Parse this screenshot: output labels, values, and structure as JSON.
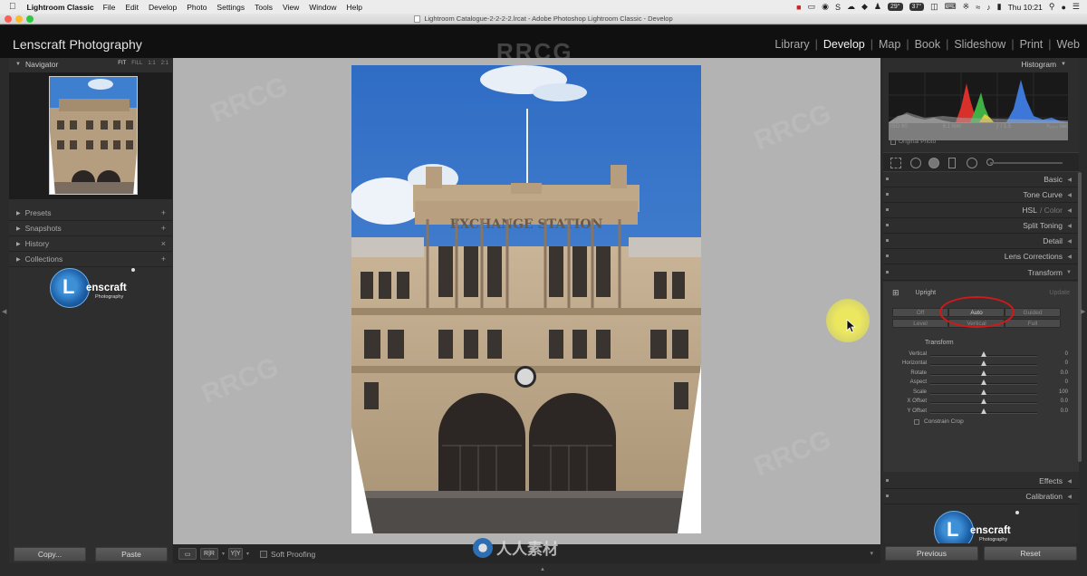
{
  "menubar": {
    "app_name": "Lightroom Classic",
    "items": [
      "File",
      "Edit",
      "Develop",
      "Photo",
      "Settings",
      "Tools",
      "View",
      "Window",
      "Help"
    ],
    "status_badges": [
      "29°",
      "37°"
    ],
    "clock": "Thu 10:21"
  },
  "window": {
    "title": "Lightroom Catalogue-2-2-2-2.lrcat - Adobe Photoshop Lightroom Classic - Develop"
  },
  "identity_plate": "Lenscraft Photography",
  "modules": [
    {
      "label": "Library",
      "active": false
    },
    {
      "label": "Develop",
      "active": true
    },
    {
      "label": "Map",
      "active": false
    },
    {
      "label": "Book",
      "active": false
    },
    {
      "label": "Slideshow",
      "active": false
    },
    {
      "label": "Print",
      "active": false
    },
    {
      "label": "Web",
      "active": false
    }
  ],
  "left_panel": {
    "navigator": {
      "title": "Navigator",
      "zoom_options": [
        "FIT",
        "FILL",
        "1:1",
        "2:1"
      ]
    },
    "sections": [
      {
        "label": "Presets",
        "action": "+"
      },
      {
        "label": "Snapshots",
        "action": "+"
      },
      {
        "label": "History",
        "action": "×"
      },
      {
        "label": "Collections",
        "action": "+"
      }
    ],
    "logo": {
      "letter": "L",
      "name": "enscraft",
      "sub": "Photography"
    },
    "buttons": {
      "copy": "Copy...",
      "paste": "Paste"
    }
  },
  "photo": {
    "sign_text": "EXCHANGE STATION"
  },
  "toolbar": {
    "soft_proofing": "Soft Proofing"
  },
  "right_panel": {
    "histogram": {
      "title": "Histogram",
      "iso": "ISO 80",
      "focal": "6.1 mm",
      "aperture": "ƒ / 1.5",
      "shutter": "¹⁄₃₂₀₀ sec",
      "original_photo": "Original Photo"
    },
    "sections": [
      "Basic",
      "Tone Curve",
      "HSL",
      "/ Color",
      "Split Toning",
      "Detail",
      "Lens Corrections",
      "Transform",
      "Effects",
      "Calibration"
    ],
    "transform": {
      "upright_label": "Upright",
      "update_label": "Update",
      "upright_buttons": [
        {
          "label": "Off",
          "active": false
        },
        {
          "label": "Auto",
          "active": true
        },
        {
          "label": "Guided",
          "active": false
        },
        {
          "label": "Level",
          "active": false
        },
        {
          "label": "Vertical",
          "active": false
        },
        {
          "label": "Full",
          "active": false
        }
      ],
      "transform_label": "Transform",
      "sliders": [
        {
          "label": "Vertical",
          "value": "0",
          "pos": 0.5
        },
        {
          "label": "Horizontal",
          "value": "0",
          "pos": 0.5
        },
        {
          "label": "Rotate",
          "value": "0.0",
          "pos": 0.5
        },
        {
          "label": "Aspect",
          "value": "0",
          "pos": 0.5
        },
        {
          "label": "Scale",
          "value": "100",
          "pos": 0.5
        },
        {
          "label": "X Offset",
          "value": "0.0",
          "pos": 0.5
        },
        {
          "label": "Y Offset",
          "value": "0.0",
          "pos": 0.5
        }
      ],
      "constrain_crop": "Constrain Crop"
    },
    "buttons": {
      "previous": "Previous",
      "reset": "Reset"
    }
  },
  "watermark": {
    "text": "RRCG",
    "cn_text": "人人素材"
  }
}
